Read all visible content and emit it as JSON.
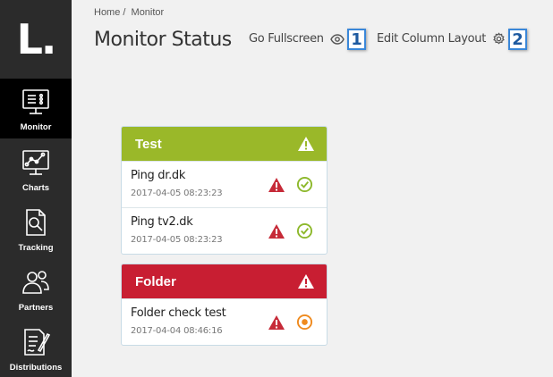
{
  "logo": "L.",
  "sidebar": {
    "items": [
      {
        "label": "Monitor",
        "icon": "monitor-icon",
        "active": true
      },
      {
        "label": "Charts",
        "icon": "chart-icon",
        "active": false
      },
      {
        "label": "Tracking",
        "icon": "tracking-icon",
        "active": false
      },
      {
        "label": "Partners",
        "icon": "partners-icon",
        "active": false
      },
      {
        "label": "Distributions",
        "icon": "distributions-icon",
        "active": false
      }
    ]
  },
  "breadcrumb": {
    "home": "Home /",
    "current": "Monitor"
  },
  "header": {
    "title": "Monitor Status",
    "fullscreen_label": "Go Fullscreen",
    "edit_layout_label": "Edit Column Layout",
    "callout_1": "1",
    "callout_2": "2"
  },
  "colors": {
    "test_group": "#9ab829",
    "folder_group": "#c81e32",
    "warning": "#c62a38",
    "ok": "#8db82b",
    "pending": "#ef8a1e"
  },
  "groups": [
    {
      "title": "Test",
      "status_icon": "warning-icon",
      "rows": [
        {
          "name": "Ping dr.dk",
          "time": "2017-04-05 08:23:23",
          "status": "ok"
        },
        {
          "name": "Ping tv2.dk",
          "time": "2017-04-05 08:23:23",
          "status": "ok"
        }
      ]
    },
    {
      "title": "Folder",
      "status_icon": "warning-icon",
      "rows": [
        {
          "name": "Folder check test",
          "time": "2017-04-04 08:46:16",
          "status": "pending"
        }
      ]
    }
  ]
}
